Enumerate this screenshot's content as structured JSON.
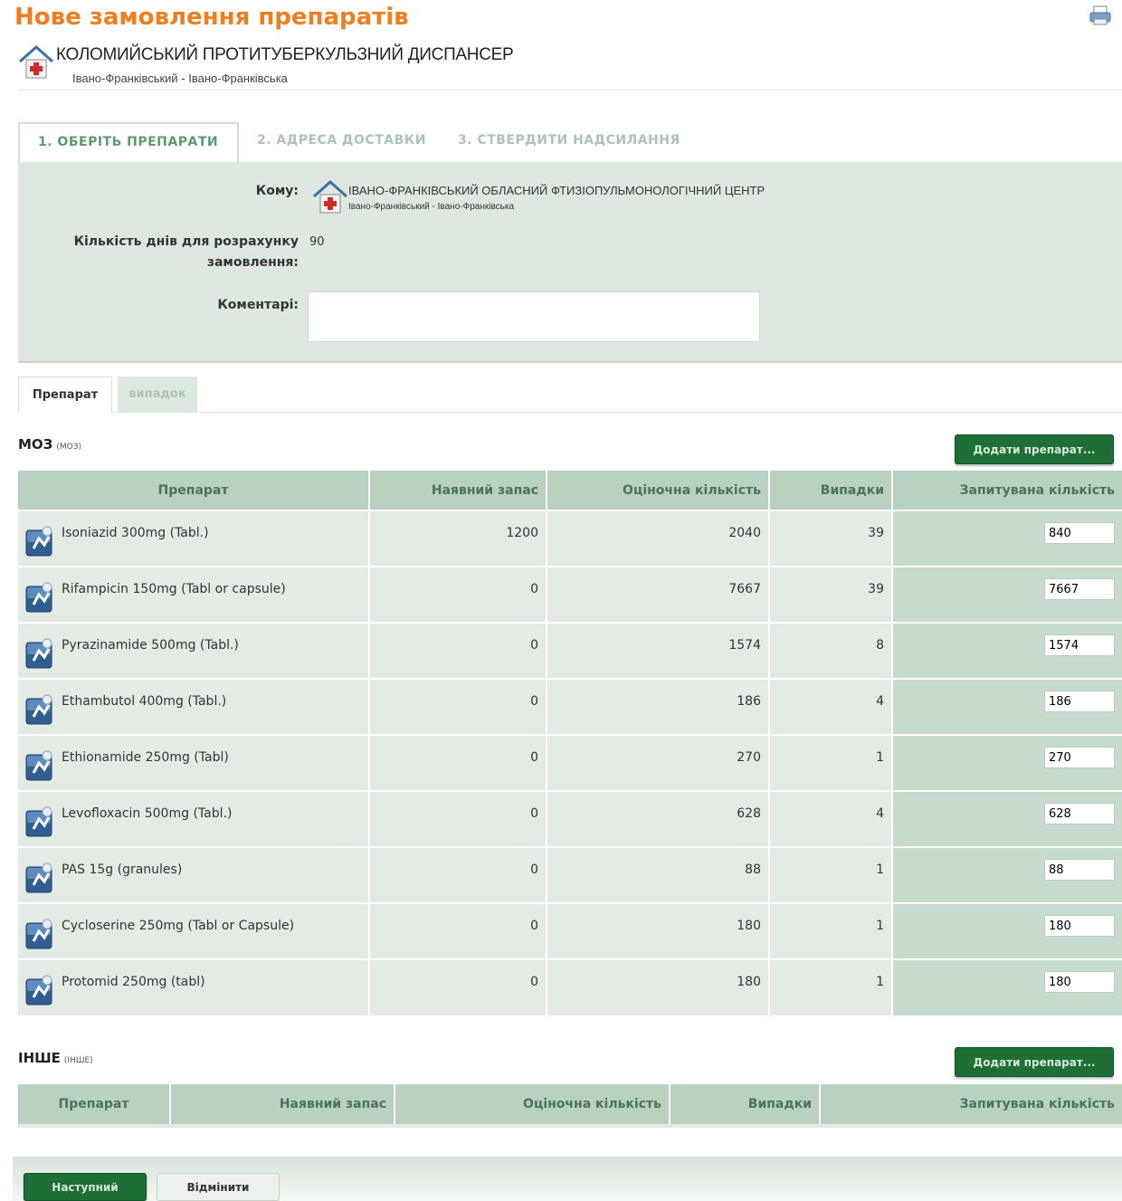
{
  "page": {
    "title": "Нове замовлення препаратів"
  },
  "facility": {
    "name": "КОЛОМИЙСЬКИЙ ПРОТИТУБЕРКУЛЬЗНИЙ ДИСПАНСЕР",
    "location": "Івано-Франківський - Івано-Франківська"
  },
  "wizard": {
    "tabs": [
      {
        "label": "1. ОБЕРІТЬ ПРЕПАРАТИ"
      },
      {
        "label": "2. АДРЕСА ДОСТАВКИ"
      },
      {
        "label": "3. СТВЕРДИТИ НАДСИЛАННЯ"
      }
    ]
  },
  "form": {
    "to_label": "Кому:",
    "to_name": "ІВАНО-ФРАНКІВСЬКИЙ ОБЛАСНИЙ ФТИЗІОПУЛЬМОНОЛОГІЧНИЙ ЦЕНТР",
    "to_location": "Івано-Франківський - Івано-Франківська",
    "days_label_1": "Кількість днів для розрахунку",
    "days_label_2": "замовлення:",
    "days_value": "90",
    "comments_label": "Коментарі:",
    "comments_value": ""
  },
  "subtabs": [
    {
      "label": "Препарат"
    },
    {
      "label": "випадок"
    }
  ],
  "moz": {
    "title": "МОЗ",
    "code": "(МОЗ)",
    "add_button": "Додати препарат...",
    "columns": [
      "Препарат",
      "Наявний запас",
      "Оціночна кількість",
      "Випадки",
      "Запитувана кількість"
    ],
    "rows": [
      {
        "drug": "Isoniazid 300mg (Tabl.)",
        "stock": "1200",
        "estimate": "2040",
        "cases": "39",
        "requested": "840"
      },
      {
        "drug": "Rifampicin 150mg (Tabl or capsule)",
        "stock": "0",
        "estimate": "7667",
        "cases": "39",
        "requested": "7667"
      },
      {
        "drug": "Pyrazinamide 500mg (Tabl.)",
        "stock": "0",
        "estimate": "1574",
        "cases": "8",
        "requested": "1574"
      },
      {
        "drug": "Ethambutol 400mg (Tabl.)",
        "stock": "0",
        "estimate": "186",
        "cases": "4",
        "requested": "186"
      },
      {
        "drug": "Ethionamide 250mg (Tabl)",
        "stock": "0",
        "estimate": "270",
        "cases": "1",
        "requested": "270"
      },
      {
        "drug": "Levofloxacin 500mg (Tabl.)",
        "stock": "0",
        "estimate": "628",
        "cases": "4",
        "requested": "628"
      },
      {
        "drug": "PAS 15g (granules)",
        "stock": "0",
        "estimate": "88",
        "cases": "1",
        "requested": "88"
      },
      {
        "drug": "Cycloserine 250mg (Tabl or Capsule)",
        "stock": "0",
        "estimate": "180",
        "cases": "1",
        "requested": "180"
      },
      {
        "drug": "Protomid 250mg (tabl)",
        "stock": "0",
        "estimate": "180",
        "cases": "1",
        "requested": "180"
      }
    ]
  },
  "other": {
    "title": "ІНШЕ",
    "code": "(ІНШЕ)",
    "add_button": "Додати препарат...",
    "columns": [
      "Препарат",
      "Наявний запас",
      "Оціночна кількість",
      "Випадки",
      "Запитувана кількість"
    ]
  },
  "footer": {
    "next_button": "Наступний",
    "cancel_button": "Відмінити"
  },
  "colors": {
    "title_orange": "#f07e1e",
    "button_green": "#1e6e35",
    "header_green": "#b9d1c1",
    "row_bg": "#e3ebe4"
  }
}
